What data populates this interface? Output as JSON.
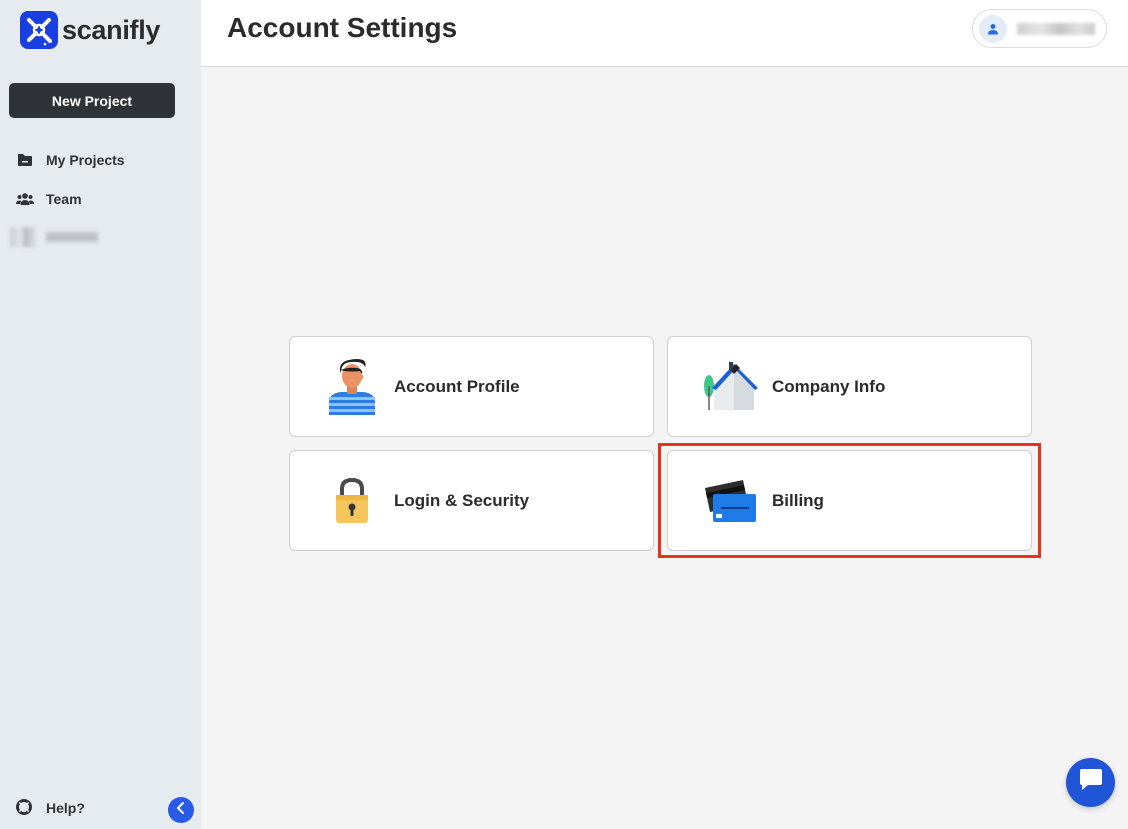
{
  "app": {
    "name": "scanifly",
    "brand_color": "#1a3fe0"
  },
  "sidebar": {
    "new_project_label": "New Project",
    "items": [
      {
        "label": "My Projects",
        "icon": "folder-icon"
      },
      {
        "label": "Team",
        "icon": "team-icon"
      }
    ],
    "help_label": "Help?"
  },
  "header": {
    "title": "Account Settings"
  },
  "cards": [
    {
      "label": "Account Profile",
      "icon": "person-icon"
    },
    {
      "label": "Company Info",
      "icon": "house-icon"
    },
    {
      "label": "Login & Security",
      "icon": "padlock-icon"
    },
    {
      "label": "Billing",
      "icon": "credit-card-icon",
      "highlighted": true
    }
  ],
  "colors": {
    "highlight": "#e8321c",
    "accent": "#2a5ae8",
    "sidebar_bg": "#e6ebef"
  }
}
